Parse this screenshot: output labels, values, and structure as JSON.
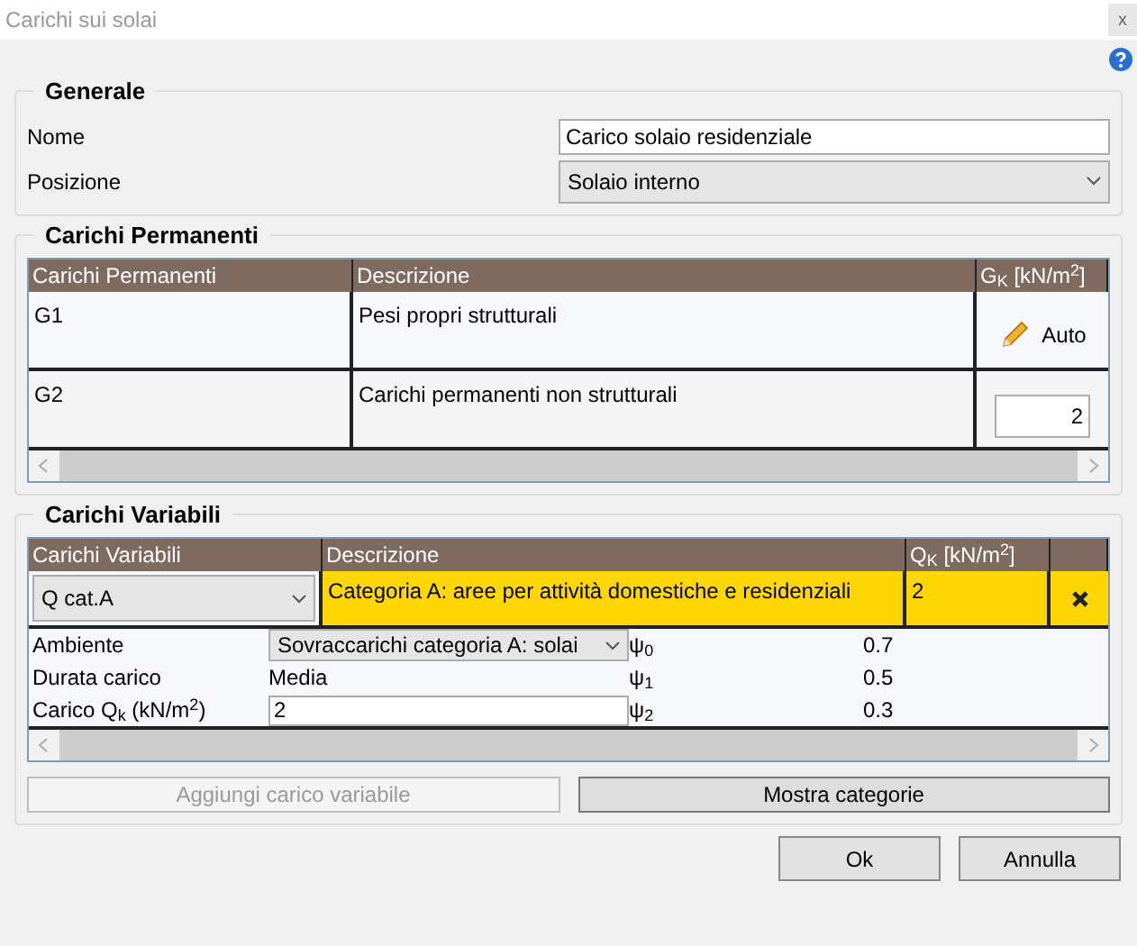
{
  "window": {
    "title": "Carichi sui solai",
    "close": "x"
  },
  "generale": {
    "title": "Generale",
    "fields": [
      {
        "label": "Nome",
        "kind": "text",
        "value": "Carico solaio residenziale"
      },
      {
        "label": "Posizione",
        "kind": "select",
        "value": "Solaio interno"
      }
    ]
  },
  "permanenti": {
    "title": "Carichi Permanenti",
    "columns": [
      "Carichi Permanenti",
      "Descrizione",
      "G$_{K}$ [kN/m$^{2}$]"
    ],
    "rows": [
      {
        "name": "G1",
        "description": "Pesi propri strutturali",
        "kind": "auto",
        "value": "Auto"
      },
      {
        "name": "G2",
        "description": "Carichi permanenti non strutturali",
        "kind": "input",
        "value": "2"
      }
    ]
  },
  "variabili": {
    "title": "Carichi Variabili",
    "columns": [
      "Carichi Variabili",
      "Descrizione",
      "Q$_{K}$ [kN/m$^{2}$]"
    ],
    "rows": [
      {
        "type": "Q cat.A",
        "description": "Categoria A: aree per attività domestiche e residenziali",
        "value": "2",
        "selected": true,
        "details": [
          {
            "label": "Ambiente",
            "kind": "select",
            "value": "Sovraccarichi categoria A: solai",
            "psi": "ψ$_{0}$",
            "psi_value": "0.7"
          },
          {
            "label": "Durata carico",
            "kind": "text",
            "value": "Media",
            "psi": "ψ$_{1}$",
            "psi_value": "0.5"
          },
          {
            "label": "Carico Q$_{k}$ (kN/m$^{2}$)",
            "kind": "input",
            "value": "2",
            "psi": "ψ$_{2}$",
            "psi_value": "0.3"
          }
        ]
      }
    ]
  },
  "actions": [
    {
      "label": "Aggiungi carico variabile",
      "disabled": true
    },
    {
      "label": "Mostra categorie",
      "disabled": false
    }
  ],
  "buttons": [
    "Ok",
    "Annulla"
  ]
}
